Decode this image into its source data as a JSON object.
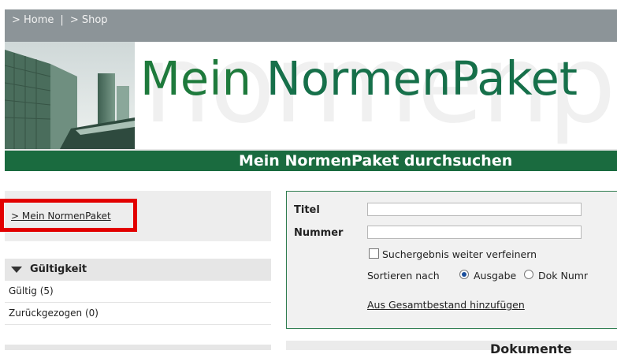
{
  "nav": {
    "home": "> Home",
    "separator": "|",
    "shop": "> Shop"
  },
  "banner": {
    "logo_mein": "Mein",
    "logo_rest": " NormenPaket",
    "bg_word": "normenpaket"
  },
  "searchbar": {
    "title": "Mein NormenPaket durchsuchen"
  },
  "sidebar": {
    "my_link": "> Mein NormenPaket",
    "facet_title": "Gültigkeit",
    "facet_items": [
      {
        "label": "Gültig (5)"
      },
      {
        "label": "Zurückgezogen (0)"
      }
    ]
  },
  "search": {
    "title_label": "Titel",
    "title_value": "",
    "number_label": "Nummer",
    "number_value": "",
    "refine_label": "Suchergebnis weiter verfeinern",
    "sort_label": "Sortieren nach",
    "sort_option_1": "Ausgabe",
    "sort_option_2": "Dok Numr",
    "add_link": "Aus Gesamtbestand hinzufügen"
  },
  "bottom_panel": {
    "title_partial": "Dokumente"
  },
  "colors": {
    "accent_green": "#1a6b3f",
    "highlight_red": "#e20000",
    "top_bar": "#8c9498"
  }
}
